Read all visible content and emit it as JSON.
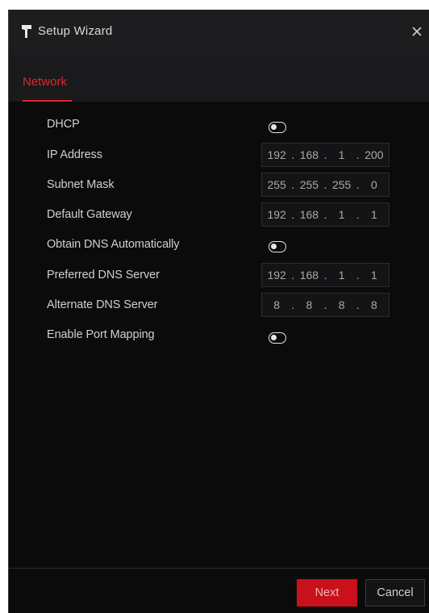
{
  "window": {
    "title": "Setup Wizard",
    "title_icon": "wizard-icon",
    "close_icon": "close-icon"
  },
  "tabs": [
    {
      "label": "Network",
      "active": true
    }
  ],
  "form": {
    "dhcp": {
      "label": "DHCP",
      "enabled": false
    },
    "ip_address": {
      "label": "IP Address",
      "octets": [
        "192",
        "168",
        "1",
        "200"
      ]
    },
    "subnet_mask": {
      "label": "Subnet Mask",
      "octets": [
        "255",
        "255",
        "255",
        "0"
      ]
    },
    "default_gateway": {
      "label": "Default Gateway",
      "octets": [
        "192",
        "168",
        "1",
        "1"
      ]
    },
    "obtain_dns": {
      "label": "Obtain DNS Automatically",
      "enabled": false
    },
    "preferred_dns": {
      "label": "Preferred DNS Server",
      "octets": [
        "192",
        "168",
        "1",
        "1"
      ]
    },
    "alternate_dns": {
      "label": "Alternate DNS Server",
      "octets": [
        "8",
        "8",
        "8",
        "8"
      ]
    },
    "port_mapping": {
      "label": "Enable Port Mapping",
      "enabled": false
    }
  },
  "footer": {
    "next_label": "Next",
    "cancel_label": "Cancel"
  },
  "colors": {
    "accent": "#e0262d",
    "background": "#0b0b0c",
    "panel": "#1d1d1f"
  }
}
